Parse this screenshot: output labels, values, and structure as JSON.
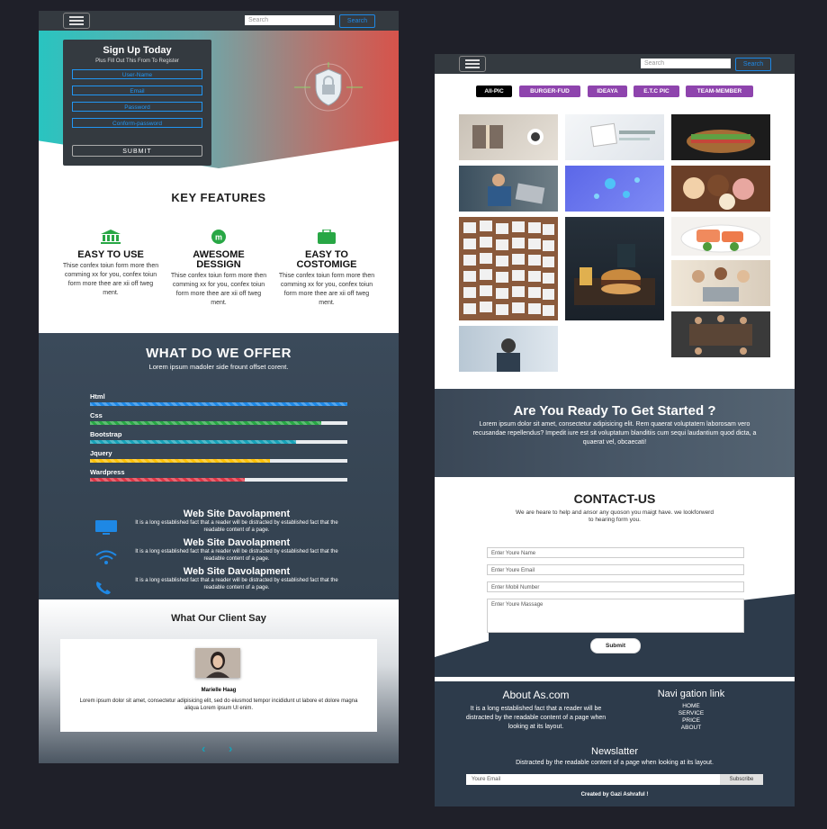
{
  "left": {
    "navbar": {
      "search_placeholder": "Search",
      "search_button": "Search"
    },
    "signup": {
      "title": "Sign Up Today",
      "subtitle": "Plus Fill Out This From To Register",
      "fields": [
        "User-Name",
        "Email",
        "Password",
        "Conform-password"
      ],
      "submit": "SUBMIT"
    },
    "features": {
      "title": "KEY FEATURES",
      "items": [
        {
          "icon": "bank-icon",
          "title": "EASY TO USE",
          "text": "Thise confex toiun form more then comming xx for you, confex toiun form more thee are xii off tweg ment."
        },
        {
          "icon": "m-badge-icon",
          "title": "AWESOME DESSIGN",
          "text": "Thise confex toiun form more then comming xx for you, confex toiun form more thee are xii off tweg ment."
        },
        {
          "icon": "suitcase-icon",
          "title": "EASY TO COSTOMIGE",
          "text": "Thise confex toiun form more then comming xx for you, confex toiun form more thee are xii off tweg ment."
        }
      ]
    },
    "offer": {
      "title": "WHAT DO WE OFFER",
      "lead": "Lorem ipsum madoler side frount offset corent.",
      "skills": [
        {
          "name": "Html",
          "value": 100,
          "color": "#1e88e5"
        },
        {
          "name": "Css",
          "value": 90,
          "color": "#28a745"
        },
        {
          "name": "Bootstrap",
          "value": 80,
          "color": "#17a2b8"
        },
        {
          "name": "Jquery",
          "value": 70,
          "color": "#ffc107"
        },
        {
          "name": "Wardpress",
          "value": 60,
          "color": "#dc3545"
        }
      ],
      "services": [
        {
          "icon": "monitor-icon",
          "title": "Web Site Davolapment",
          "text": "It is a long established fact that a reader will be distracted by established fact that the readable content of a page."
        },
        {
          "icon": "wifi-icon",
          "title": "Web Site Davolapment",
          "text": "It is a long established fact that a reader will be distracted by established fact that the readable content of a page."
        },
        {
          "icon": "phone-icon",
          "title": "Web Site Davolapment",
          "text": "It is a long established fact that a reader will be distracted by established fact that the readable content of a page."
        }
      ]
    },
    "clients": {
      "title": "What Our Client Say",
      "name": "Marielle Haag",
      "quote": "Lorem ipsum dolor sit amet, consectetur adipisicing elit, sed do eiusmod tempor incididunt ut labore et dolore magna aliqua Lorem ipsum Ul enim.",
      "prev": "‹",
      "next": "›"
    }
  },
  "right": {
    "navbar": {
      "search_placeholder": "Search",
      "search_button": "Search"
    },
    "filters": [
      "All-PIC",
      "BURGER-FUD",
      "IDEAYA",
      "E.T.C PIC",
      "TEAM-MEMBER"
    ],
    "cta": {
      "title": "Are You Ready To Get Started ?",
      "text": "Lorem ipsum dolor sit amet, consectetur adipisicing elit. Rem quaerat voluptatem laborosam vero recusandae repellendus? Impedit iure est sit voluptatum blanditiis cum sequi laudantium quod dicta, a quaerat vel, obcaecati!"
    },
    "contact": {
      "title": "CONTACT-US",
      "subtitle": "We are heare to help and ansor any quoson you maigt have. we lookforwerd to hearing form you.",
      "name_placeholder": "Enter Youre Name",
      "email_placeholder": "Enter Youre Email",
      "mobile_placeholder": "Enter Mobil Number",
      "message_placeholder": "Enter Youre Massage",
      "submit": "Submit"
    },
    "footer": {
      "about_title": "About As.com",
      "about_text": "It is a long established fact that a reader will be distracted by the readable content of a page when looking at its layout.",
      "nav_title": "Navi gation link",
      "nav_links": [
        "HOME",
        "SERVICE",
        "PRICE",
        "ABOUT"
      ],
      "newsletter_title": "Newslatter",
      "newsletter_text": "Distracted by the readable content of a page when looking at its layout.",
      "email_placeholder": "Youre Email",
      "subscribe": "Subscribe",
      "credit": "Created by Gazi Ashraful !"
    }
  }
}
